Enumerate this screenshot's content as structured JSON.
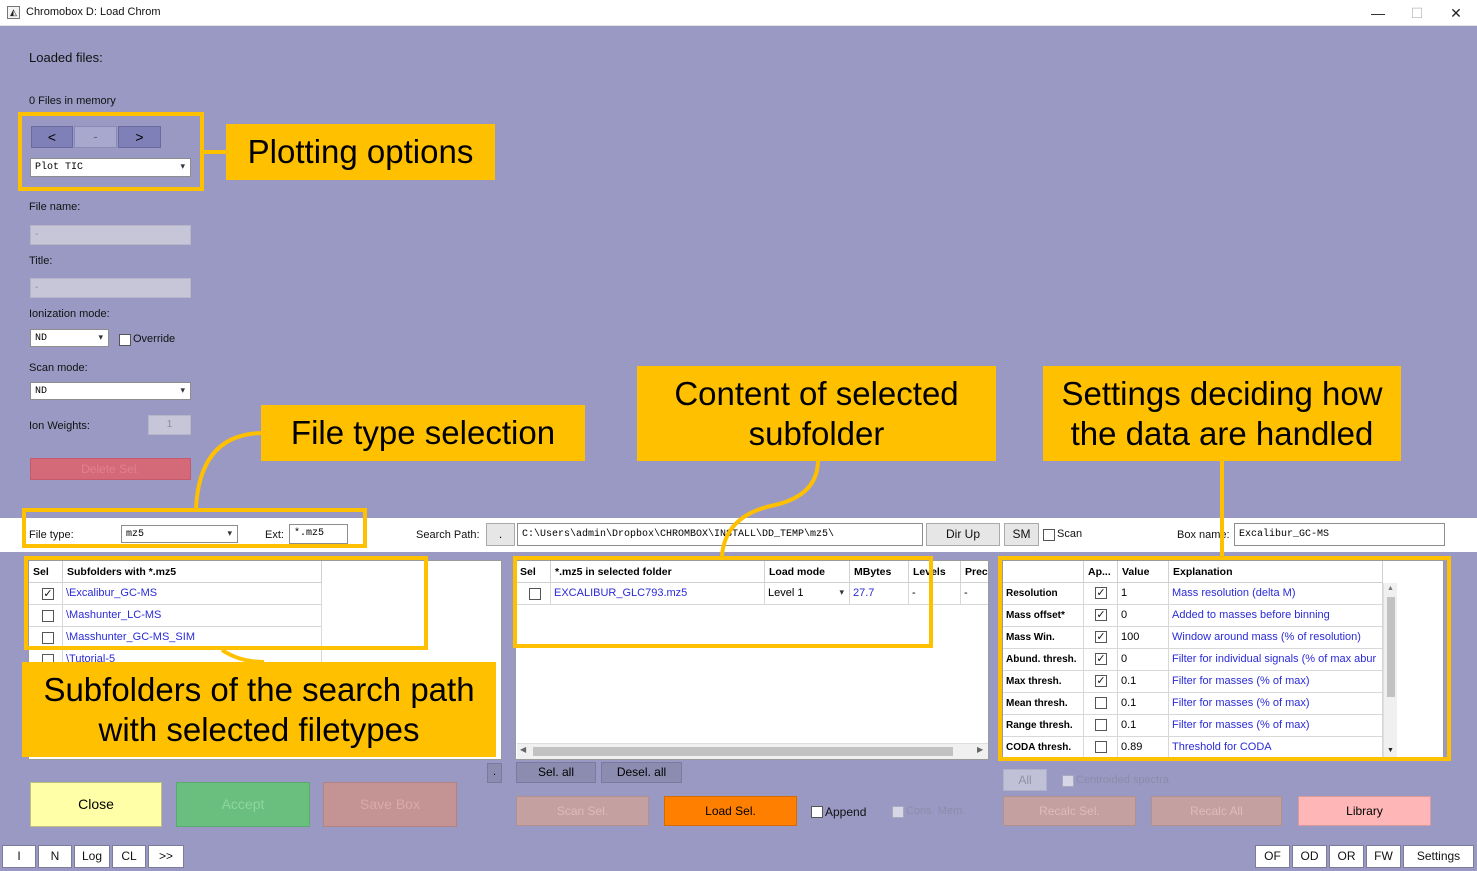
{
  "window": {
    "title": "Chromobox D: Load Chrom",
    "icon_glyph": "◭",
    "minimize_glyph": "—",
    "maximize_glyph": "☐",
    "close_glyph": "✕"
  },
  "left_panel": {
    "loaded_files_label": "Loaded files:",
    "files_in_memory": "0 Files in memory",
    "nav_prev": "<",
    "nav_mid": "-",
    "nav_next": ">",
    "plot_select": "Plot TIC",
    "file_name_label": "File name:",
    "file_name_value": "-",
    "title_label": "Title:",
    "title_value": "-",
    "ionization_label": "Ionization mode:",
    "ionization_value": "ND",
    "override_label": "Override",
    "scan_mode_label": "Scan mode:",
    "scan_mode_value": "ND",
    "ion_weights_label": "Ion Weights:",
    "ion_weights_value": "1",
    "delete_sel_label": "Delete Sel."
  },
  "search_bar": {
    "file_type_label": "File type:",
    "file_type_value": "mz5",
    "ext_label": "Ext:",
    "ext_value": "*.mz5",
    "search_path_label": "Search Path:",
    "dot_button": ".",
    "search_path_value": "C:\\Users\\admin\\Dropbox\\CHROMBOX\\INSTALL\\DD_TEMP\\mz5\\",
    "dir_up_label": "Dir Up",
    "sm_label": "SM",
    "scan_label": "Scan",
    "box_name_label": "Box name:",
    "box_name_value": "Excalibur_GC-MS"
  },
  "subfolders_table": {
    "headers": [
      "Sel",
      "Subfolders with *.mz5"
    ],
    "rows": [
      {
        "checked": true,
        "name": "\\Excalibur_GC-MS"
      },
      {
        "checked": false,
        "name": "\\Mashunter_LC-MS"
      },
      {
        "checked": false,
        "name": "\\Masshunter_GC-MS_SIM"
      },
      {
        "checked": false,
        "name": "\\Tutorial-5"
      }
    ],
    "small_button": "."
  },
  "files_table": {
    "headers": [
      "Sel",
      "*.mz5 in selected folder",
      "Load mode",
      "MBytes",
      "Levels",
      "Prec."
    ],
    "rows": [
      {
        "checked": false,
        "name": "EXCALIBUR_GLC793.mz5",
        "load_mode": "Level 1",
        "mbytes": "27.7",
        "levels": "-",
        "prec": "-"
      }
    ],
    "sel_all": "Sel. all",
    "desel_all": "Desel. all"
  },
  "settings_table": {
    "headers": [
      "",
      "Ap...",
      "Value",
      "Explanation"
    ],
    "rows": [
      {
        "name": "Resolution",
        "checked": true,
        "value": "1",
        "explanation": "Mass resolution (delta M)"
      },
      {
        "name": "Mass offset*",
        "checked": true,
        "value": "0",
        "explanation": "Added to masses before binning"
      },
      {
        "name": "Mass Win.",
        "checked": true,
        "value": "100",
        "explanation": "Window around mass (% of resolution)"
      },
      {
        "name": "Abund. thresh.",
        "checked": true,
        "value": "0",
        "explanation": "Filter for individual signals (% of max abur"
      },
      {
        "name": "Max thresh.",
        "checked": true,
        "value": "0.1",
        "explanation": "Filter for masses (% of max)"
      },
      {
        "name": "Mean thresh.",
        "checked": false,
        "value": "0.1",
        "explanation": "Filter for masses (% of max)"
      },
      {
        "name": "Range thresh.",
        "checked": false,
        "value": "0.1",
        "explanation": "Filter for masses (% of max)"
      },
      {
        "name": "CODA thresh.",
        "checked": false,
        "value": "0.89",
        "explanation": "Threshold for CODA"
      }
    ],
    "all_button": "All",
    "centroided_label": "Centroided spectra"
  },
  "bottom_buttons": {
    "close": "Close",
    "accept": "Accept",
    "save_box": "Save Box",
    "scan_sel": "Scan Sel.",
    "load_sel": "Load Sel.",
    "append": "Append",
    "cons_mem": "Cons. Mem.",
    "recalc_sel": "Recalc Sel.",
    "recalc_all": "Recalc All",
    "library": "Library"
  },
  "bottom_bar": {
    "left": [
      "I",
      "N",
      "Log",
      "CL",
      ">>"
    ],
    "right": [
      "OF",
      "OD",
      "OR",
      "FW",
      "Settings"
    ]
  },
  "callouts": {
    "plotting": "Plotting options",
    "file_type": "File type selection",
    "content_line1": "Content of selected",
    "content_line2": "subfolder",
    "settings_line1": "Settings deciding how",
    "settings_line2": "the data are handled",
    "subfolders_line1": "Subfolders of the search path",
    "subfolders_line2": "with selected filetypes"
  },
  "colors": {
    "background": "#9999c4",
    "callout": "#ffc000",
    "link": "#2a2ad8",
    "close_button": "#ffffa8",
    "accept_button": "#6abf7e",
    "save_box_button": "#c49494",
    "load_sel_button": "#ff7f00",
    "library_button": "#ffb6b6"
  }
}
